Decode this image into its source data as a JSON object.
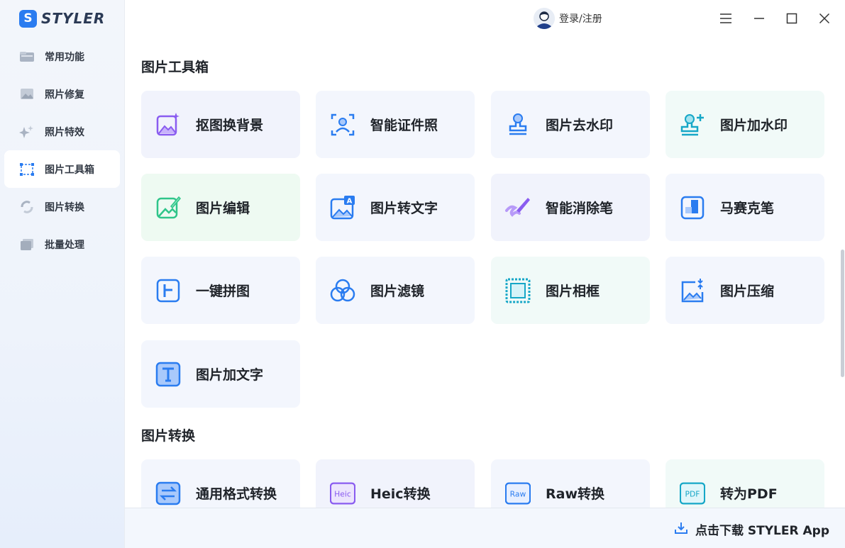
{
  "app": {
    "logo_letter": "S",
    "logo_text": "STYLER"
  },
  "sidebar": {
    "items": [
      {
        "label": "常用功能",
        "icon": "folder-icon"
      },
      {
        "label": "照片修复",
        "icon": "photo-icon"
      },
      {
        "label": "照片特效",
        "icon": "sparkle-icon"
      },
      {
        "label": "图片工具箱",
        "icon": "toolbox-icon",
        "active": true
      },
      {
        "label": "图片转换",
        "icon": "convert-icon"
      },
      {
        "label": "批量处理",
        "icon": "batch-icon"
      }
    ]
  },
  "header": {
    "user_label": "登录/注册"
  },
  "sections": {
    "toolbox": {
      "title": "图片工具箱",
      "cards": [
        {
          "label": "抠图换背景",
          "icon": "cutout-icon"
        },
        {
          "label": "智能证件照",
          "icon": "id-photo-icon"
        },
        {
          "label": "图片去水印",
          "icon": "remove-watermark-icon"
        },
        {
          "label": "图片加水印",
          "icon": "add-watermark-icon"
        },
        {
          "label": "图片编辑",
          "icon": "edit-icon"
        },
        {
          "label": "图片转文字",
          "icon": "image-to-text-icon"
        },
        {
          "label": "智能消除笔",
          "icon": "eraser-brush-icon"
        },
        {
          "label": "马赛克笔",
          "icon": "mosaic-icon"
        },
        {
          "label": "一键拼图",
          "icon": "collage-icon"
        },
        {
          "label": "图片滤镜",
          "icon": "filter-icon"
        },
        {
          "label": "图片相框",
          "icon": "frame-icon"
        },
        {
          "label": "图片压缩",
          "icon": "compress-icon"
        },
        {
          "label": "图片加文字",
          "icon": "add-text-icon"
        }
      ]
    },
    "convert": {
      "title": "图片转换",
      "cards": [
        {
          "label": "通用格式转换",
          "icon": "format-convert-icon"
        },
        {
          "label": "Heic转换",
          "icon": "heic-icon",
          "badge": "Heic"
        },
        {
          "label": "Raw转换",
          "icon": "raw-icon",
          "badge": "Raw"
        },
        {
          "label": "转为PDF",
          "icon": "pdf-icon",
          "badge": "PDF"
        }
      ]
    }
  },
  "footer": {
    "download_label": "点击下载 STYLER App"
  },
  "colors": {
    "accent": "#2a7cf0",
    "purple": "#8a5cf0",
    "green": "#2fc58a",
    "text": "#1f2329"
  }
}
